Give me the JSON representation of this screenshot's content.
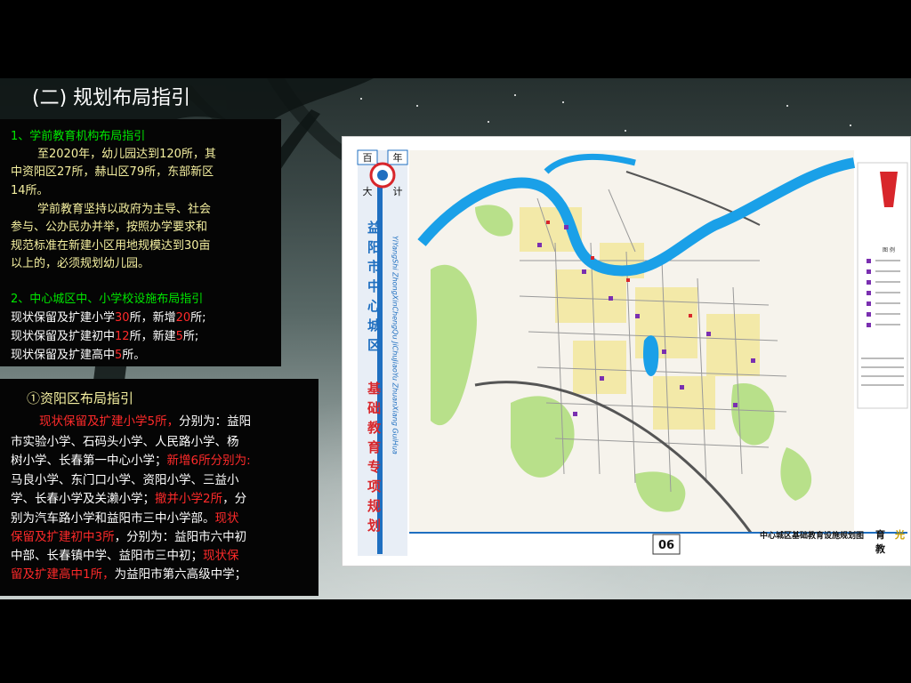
{
  "slide": {
    "title": "(二) 规划布局指引"
  },
  "section1": {
    "heading": "1、学前教育机构布局指引",
    "lines": [
      "至2020年，幼儿园达到120所，其",
      "中资阳区27所，赫山区79所，东部新区",
      "14所。",
      "学前教育坚持以政府为主导、社会",
      "参与、公办民办并举，按照办学要求和",
      "规范标准在新建小区用地规模达到30亩",
      "以上的，必须规划幼儿园。"
    ]
  },
  "section2": {
    "heading": "2、中心城区中、小学校设施布局指引",
    "row1": {
      "a": "现状保留及扩建小学",
      "n1": "30",
      "b": "所，新增",
      "n2": "20",
      "c": "所;"
    },
    "row2": {
      "a": "现状保留及扩建初中",
      "n1": "12",
      "b": "所，新建",
      "n2": "5",
      "c": "所;"
    },
    "row3": {
      "a": "现状保留及扩建高中",
      "n1": "5",
      "b": "所。"
    }
  },
  "ziyang": {
    "heading": "①资阳区布局指引",
    "l1_red": "现状保留及扩建小学5所，",
    "l1_white": "分别为：益阳",
    "l2": "市实验小学、石码头小学、人民路小学、杨",
    "l3_white": "树小学、长春第一中心小学；",
    "l3_red": "新增6所分别为:",
    "l4": "马良小学、东门口小学、资阳小学、三益小",
    "l5_white": "学、长春小学及关濑小学；",
    "l5_red": "撤并小学2所",
    "l5_white2": "，分",
    "l6_white": "别为汽车路小学和益阳市三中小学部。",
    "l6_red": "现状",
    "l7_red": "保留及扩建初中3所",
    "l7_white": "，分别为：益阳市六中初",
    "l8_white": "中部、长春镇中学、益阳市三中初；",
    "l8_red": "现状保",
    "l9_red": "留及扩建高中1所，",
    "l9_white": "为益阳市第六高级中学；"
  },
  "map": {
    "side_top": [
      "百",
      "年",
      "大",
      "计"
    ],
    "vertical_title_blue": "益阳市中心城区",
    "vertical_title_red": "基础教育专项规划",
    "pinyin": "YiYangShi ZhongXinChengQu JiChuJiaoYu ZhuanXiang GuiHua",
    "page_no": "06",
    "caption": "中心城区基础教育设施规划图",
    "corner_chars": [
      "育",
      "教",
      "光"
    ],
    "legend_title": "图 例",
    "colors": {
      "river": "#1aa0e8",
      "green": "#b8e08a",
      "yellow": "#f3e9a8",
      "road": "#9a9a9a",
      "school": "#7a2fb0",
      "frame_blue": "#1f6fc0",
      "accent_red": "#d8262b"
    }
  }
}
